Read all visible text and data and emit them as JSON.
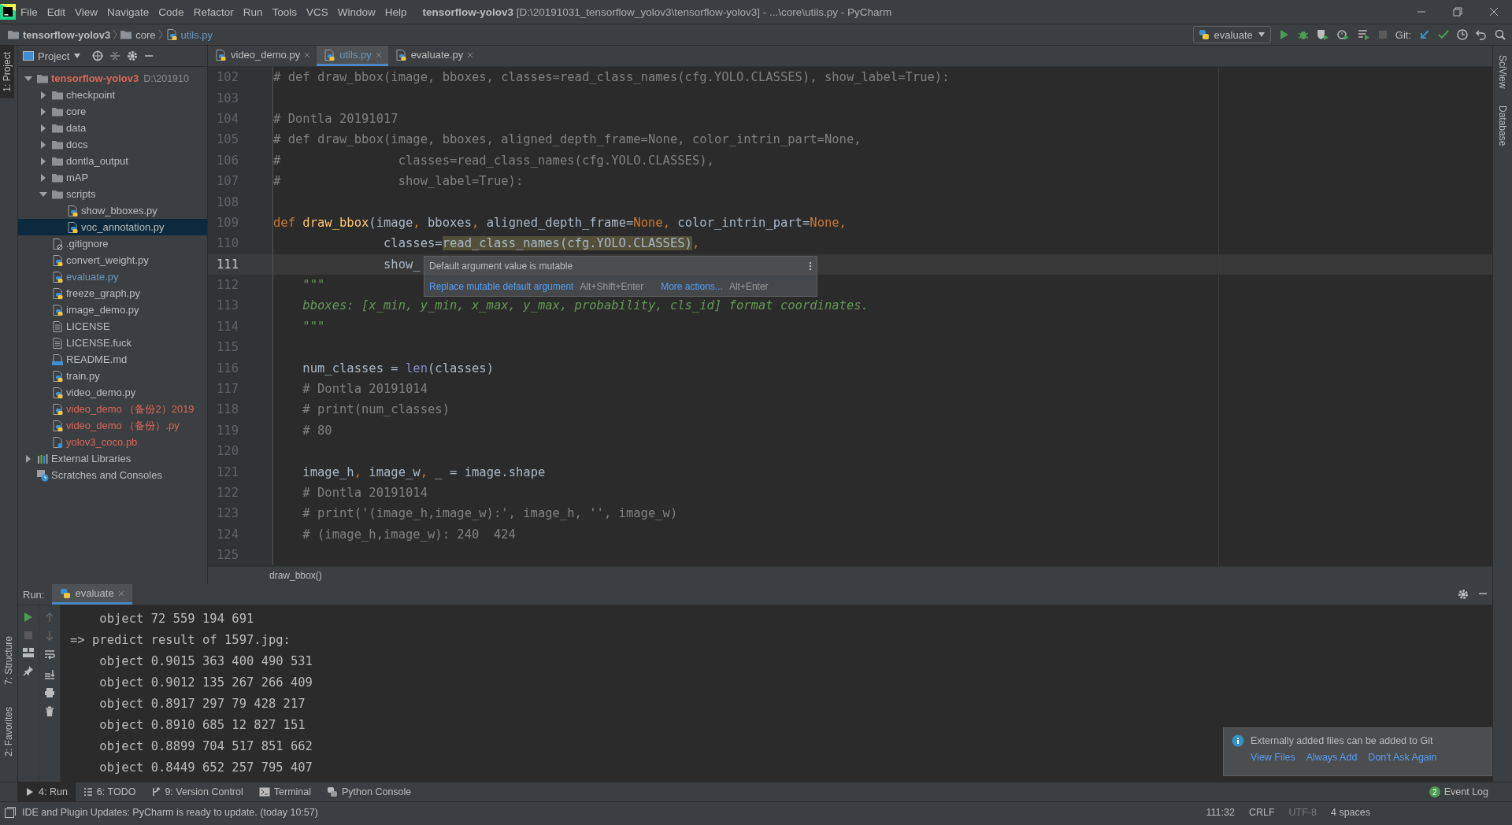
{
  "title_bar": {
    "menu": [
      "File",
      "Edit",
      "View",
      "Navigate",
      "Code",
      "Refactor",
      "Run",
      "Tools",
      "VCS",
      "Window",
      "Help"
    ],
    "title": "**tensorflow-yolov3** [D:\\20191031_tensorflow_yolov3\\tensorflow-yolov3] - ...\\core\\utils.py - PyCharm"
  },
  "navigation_bar": {
    "breadcrumbs": [
      {
        "label": "tensorflow-yolov3",
        "kind": "project"
      },
      {
        "label": "core",
        "kind": "folder"
      },
      {
        "label": "utils.py",
        "kind": "file"
      }
    ],
    "run_configuration": "evaluate",
    "vcs_label": "Git:"
  },
  "left_stripe": {
    "top": [
      {
        "label": "1: Project",
        "selected": true
      }
    ],
    "bottom": [
      {
        "label": "7: Structure",
        "selected": false
      },
      {
        "label": "2: Favorites",
        "selected": false
      }
    ]
  },
  "right_stripe": [
    {
      "label": "SciView",
      "selected": false
    },
    {
      "label": "Database",
      "selected": false
    }
  ],
  "project_panel": {
    "title": "Project",
    "tree": [
      {
        "label": "tensorflow-yolov3",
        "kind": "project",
        "hint": "D:\\201910",
        "expanded": true,
        "selected": false,
        "color": "#d9675a",
        "children": [
          {
            "label": "checkpoint",
            "kind": "folder",
            "expanded": false,
            "selected": false,
            "color": "#bbbbbb"
          },
          {
            "label": "core",
            "kind": "folder",
            "expanded": false,
            "selected": false,
            "color": "#bbbbbb"
          },
          {
            "label": "data",
            "kind": "folder",
            "expanded": false,
            "selected": false,
            "color": "#bbbbbb"
          },
          {
            "label": "docs",
            "kind": "folder",
            "expanded": false,
            "selected": false,
            "color": "#bbbbbb"
          },
          {
            "label": "dontla_output",
            "kind": "folder",
            "expanded": false,
            "selected": false,
            "color": "#bbbbbb"
          },
          {
            "label": "mAP",
            "kind": "folder",
            "expanded": false,
            "selected": false,
            "color": "#bbbbbb"
          },
          {
            "label": "scripts",
            "kind": "folder",
            "expanded": true,
            "selected": false,
            "color": "#bbbbbb",
            "children": [
              {
                "label": "show_bboxes.py",
                "kind": "python",
                "selected": false,
                "color": "#bbbbbb"
              },
              {
                "label": "voc_annotation.py",
                "kind": "python",
                "selected": true,
                "color": "#bbbbbb"
              }
            ]
          },
          {
            "label": ".gitignore",
            "kind": "ignored",
            "selected": false,
            "color": "#bbbbbb"
          },
          {
            "label": "convert_weight.py",
            "kind": "python",
            "selected": false,
            "color": "#bbbbbb"
          },
          {
            "label": "evaluate.py",
            "kind": "python",
            "selected": false,
            "color": "#6897bb"
          },
          {
            "label": "freeze_graph.py",
            "kind": "python",
            "selected": false,
            "color": "#bbbbbb"
          },
          {
            "label": "image_demo.py",
            "kind": "python",
            "selected": false,
            "color": "#bbbbbb"
          },
          {
            "label": "LICENSE",
            "kind": "text",
            "selected": false,
            "color": "#bbbbbb"
          },
          {
            "label": "LICENSE.fuck",
            "kind": "text",
            "selected": false,
            "color": "#bbbbbb"
          },
          {
            "label": "README.md",
            "kind": "markdown",
            "selected": false,
            "color": "#bbbbbb"
          },
          {
            "label": "train.py",
            "kind": "python",
            "selected": false,
            "color": "#bbbbbb"
          },
          {
            "label": "video_demo.py",
            "kind": "python",
            "selected": false,
            "color": "#bbbbbb"
          },
          {
            "label": "video_demo （备份2）2019",
            "kind": "python",
            "selected": false,
            "color": "#d9675a"
          },
          {
            "label": "video_demo （备份）.py",
            "kind": "python",
            "selected": false,
            "color": "#d9675a"
          },
          {
            "label": "yolov3_coco.pb",
            "kind": "unknown",
            "selected": false,
            "color": "#d9675a"
          }
        ]
      },
      {
        "label": "External Libraries",
        "kind": "libraries",
        "expanded": false,
        "selected": false,
        "color": "#bbbbbb"
      },
      {
        "label": "Scratches and Consoles",
        "kind": "scratches",
        "selected": false,
        "color": "#bbbbbb"
      }
    ]
  },
  "editor": {
    "tabs": [
      {
        "label": "video_demo.py",
        "selected": false
      },
      {
        "label": "utils.py",
        "selected": true
      },
      {
        "label": "evaluate.py",
        "selected": false
      }
    ],
    "lines": [
      {
        "number": "102",
        "current": false,
        "tokens": [
          {
            "kind": "comment",
            "text": "# def draw_bbox(image, bboxes, classes=read_class_names(cfg.YOLO.CLASSES), show_label=True):"
          }
        ]
      },
      {
        "number": "103",
        "current": false
      },
      {
        "number": "104",
        "current": false,
        "tokens": [
          {
            "kind": "comment",
            "text": "# Dontla 20191017"
          }
        ]
      },
      {
        "number": "105",
        "current": false,
        "tokens": [
          {
            "kind": "comment",
            "text": "# def draw_bbox(image, bboxes, aligned_depth_frame=None, color_intrin_part=None,"
          }
        ]
      },
      {
        "number": "106",
        "current": false,
        "tokens": [
          {
            "kind": "comment",
            "text": "#                classes=read_class_names(cfg.YOLO.CLASSES),"
          }
        ]
      },
      {
        "number": "107",
        "current": false,
        "tokens": [
          {
            "kind": "comment",
            "text": "#                show_label=True):"
          }
        ]
      },
      {
        "number": "108",
        "current": false
      },
      {
        "number": "109",
        "current": false,
        "tokens": [
          {
            "kind": "keyword",
            "text": "def "
          },
          {
            "kind": "function",
            "text": "draw_bbox"
          },
          {
            "kind": "plain",
            "text": "(image"
          },
          {
            "kind": "keyword",
            "text": ", "
          },
          {
            "kind": "plain",
            "text": "bboxes"
          },
          {
            "kind": "keyword",
            "text": ", "
          },
          {
            "kind": "plain",
            "text": "aligned_depth_frame="
          },
          {
            "kind": "keyword",
            "text": "None, "
          },
          {
            "kind": "plain",
            "text": "color_intrin_part="
          },
          {
            "kind": "keyword",
            "text": "None,"
          }
        ]
      },
      {
        "number": "110",
        "current": false,
        "tokens": [
          {
            "kind": "plain",
            "text": "               classes="
          },
          {
            "kind": "highlight",
            "text": "read_class_names(cfg.YOLO.CLASSES)"
          },
          {
            "kind": "keyword",
            "text": ","
          }
        ]
      },
      {
        "number": "111",
        "current": true,
        "tokens": [
          {
            "kind": "plain",
            "text": "               show_"
          }
        ]
      },
      {
        "number": "112",
        "current": false,
        "tokens": [
          {
            "kind": "docstring",
            "text": "    \"\"\""
          }
        ]
      },
      {
        "number": "113",
        "current": false,
        "tokens": [
          {
            "kind": "docstring",
            "text": "    bboxes: [x_min, y_min, x_max, y_max, probability, cls_id] format coordinates."
          }
        ]
      },
      {
        "number": "114",
        "current": false,
        "tokens": [
          {
            "kind": "docstring",
            "text": "    \"\"\""
          }
        ]
      },
      {
        "number": "115",
        "current": false
      },
      {
        "number": "116",
        "current": false,
        "tokens": [
          {
            "kind": "plain",
            "text": "    num_classes = "
          },
          {
            "kind": "builtin",
            "text": "len"
          },
          {
            "kind": "plain",
            "text": "(classes)"
          }
        ]
      },
      {
        "number": "117",
        "current": false,
        "tokens": [
          {
            "kind": "comment",
            "text": "    # Dontla 20191014"
          }
        ]
      },
      {
        "number": "118",
        "current": false,
        "tokens": [
          {
            "kind": "comment",
            "text": "    # print(num_classes)"
          }
        ]
      },
      {
        "number": "119",
        "current": false,
        "tokens": [
          {
            "kind": "comment",
            "text": "    # 80"
          }
        ]
      },
      {
        "number": "120",
        "current": false
      },
      {
        "number": "121",
        "current": false,
        "tokens": [
          {
            "kind": "plain",
            "text": "    image_h"
          },
          {
            "kind": "keyword",
            "text": ", "
          },
          {
            "kind": "plain",
            "text": "image_w"
          },
          {
            "kind": "keyword",
            "text": ", "
          },
          {
            "kind": "plain",
            "text": "_ = image.shape"
          }
        ]
      },
      {
        "number": "122",
        "current": false,
        "tokens": [
          {
            "kind": "comment",
            "text": "    # Dontla 20191014"
          }
        ]
      },
      {
        "number": "123",
        "current": false,
        "tokens": [
          {
            "kind": "comment",
            "text": "    # print('(image_h,image_w):', image_h, '', image_w)"
          }
        ]
      },
      {
        "number": "124",
        "current": false,
        "tokens": [
          {
            "kind": "comment",
            "text": "    # (image_h,image_w): 240  424"
          }
        ]
      },
      {
        "number": "125",
        "current": false
      }
    ],
    "popup": {
      "message": "Default argument value is mutable",
      "actions": [
        {
          "label": "Replace mutable default argument",
          "shortcut": "Alt+Shift+Enter"
        },
        {
          "label": "More actions...",
          "shortcut": "Alt+Enter"
        }
      ]
    },
    "breadcrumb": "draw_bbox()"
  },
  "run_panel": {
    "label": "Run:",
    "tab": "evaluate",
    "output": [
      "    object 72 559 194 691",
      "=> predict result of 1597.jpg:",
      "    object 0.9015 363 400 490 531",
      "    object 0.9012 135 267 266 409",
      "    object 0.8917 297 79 428 217",
      "    object 0.8910 685 12 827 151",
      "    object 0.8899 704 517 851 662",
      "    object 0.8449 652 257 795 407"
    ]
  },
  "notification": {
    "message": "Externally added files can be added to Git",
    "actions": [
      "View Files",
      "Always Add",
      "Don't Ask Again"
    ]
  },
  "tool_tabs": [
    {
      "label": "4: Run",
      "kind": "run",
      "selected": true
    },
    {
      "label": "6: TODO",
      "kind": "todo",
      "selected": false
    },
    {
      "label": "9: Version Control",
      "kind": "vcs",
      "selected": false
    },
    {
      "label": "Terminal",
      "kind": "terminal",
      "selected": false
    },
    {
      "label": "Python Console",
      "kind": "console",
      "selected": false
    }
  ],
  "event_log": {
    "label": "Event Log",
    "count": "2"
  },
  "status_bar": {
    "message": "IDE and Plugin Updates: PyCharm is ready to update. (today 10:57)",
    "items": [
      {
        "text": "111:32",
        "kind": "normal"
      },
      {
        "text": "CRLF",
        "kind": "normal"
      },
      {
        "text": "UTF-8",
        "kind": "dim"
      },
      {
        "text": "4 spaces",
        "kind": "normal"
      }
    ]
  }
}
